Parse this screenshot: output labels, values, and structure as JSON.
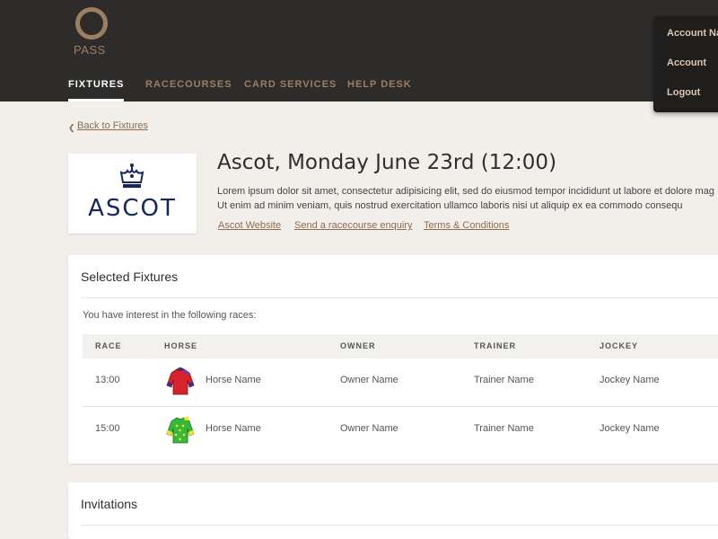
{
  "brand": {
    "logo_text": "PASS"
  },
  "nav": {
    "items": [
      {
        "label": "FIXTURES",
        "active": true
      },
      {
        "label": "RACECOURSES",
        "active": false
      },
      {
        "label": "CARD SERVICES",
        "active": false
      },
      {
        "label": "HELP DESK",
        "active": false
      }
    ]
  },
  "account_menu": {
    "items": [
      "Account Na",
      "Account",
      "Logout"
    ]
  },
  "breadcrumb": {
    "back_label": "Back to Fixtures"
  },
  "venue": {
    "logo_text": "ASCOT",
    "title": "Ascot, Monday June 23rd (12:00)",
    "description": [
      "Lorem ipsum dolor sit amet, consectetur adipisicing elit, sed do eiusmod tempor incididunt ut labore et dolore mag",
      "Ut enim ad minim veniam, quis nostrud exercitation ullamco laboris nisi ut aliquip ex ea commodo consequ"
    ],
    "links": [
      "Ascot Website",
      "Send a racecourse enquiry",
      "Terms & Conditions"
    ]
  },
  "selected_fixtures": {
    "title": "Selected Fixtures",
    "intro": "You have interest in the following races:",
    "columns": [
      "RACE",
      "HORSE",
      "OWNER",
      "TRAINER",
      "JOCKEY"
    ],
    "rows": [
      {
        "race": "13:00",
        "horse": "Horse Name",
        "owner": "Owner Name",
        "trainer": "Trainer Name",
        "jockey": "Jockey Name",
        "silk_icon": "jockey-silk-red-purple-icon"
      },
      {
        "race": "15:00",
        "horse": "Horse Name",
        "owner": "Owner Name",
        "trainer": "Trainer Name",
        "jockey": "Jockey Name",
        "silk_icon": "jockey-silk-green-yellow-icon"
      }
    ]
  },
  "invitations": {
    "title": "Invitations"
  },
  "colors": {
    "accent": "#9c7f62",
    "topbar": "#2d2c2b",
    "background": "#f2efea",
    "ascot_navy": "#16275a"
  }
}
